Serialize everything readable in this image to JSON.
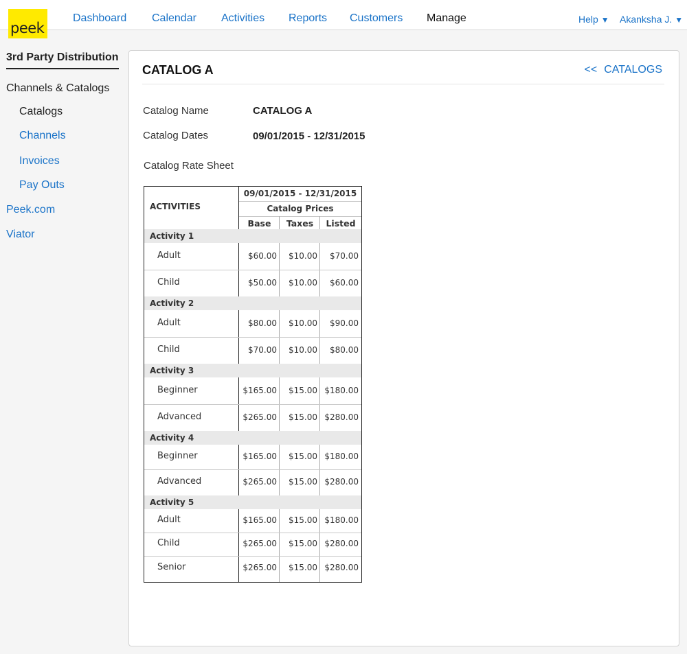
{
  "app": {
    "logo_text": "peek"
  },
  "nav": {
    "items": [
      {
        "label": "Dashboard",
        "active": false
      },
      {
        "label": "Calendar",
        "active": false
      },
      {
        "label": "Activities",
        "active": false
      },
      {
        "label": "Reports",
        "active": false
      },
      {
        "label": "Customers",
        "active": false
      },
      {
        "label": "Manage",
        "active": true
      }
    ],
    "help_label": "Help",
    "user_label": "Akanksha J."
  },
  "sidebar": {
    "heading": "3rd Party Distribution",
    "items": [
      {
        "label": "Channels & Catalogs"
      },
      {
        "label": "Catalogs"
      },
      {
        "label": "Channels"
      },
      {
        "label": "Invoices"
      },
      {
        "label": "Pay Outs"
      },
      {
        "label": "Peek.com"
      },
      {
        "label": "Viator"
      }
    ]
  },
  "catalog": {
    "title": "CATALOG A",
    "back_arrows": "<<",
    "back_label": "CATALOGS",
    "name_label": "Catalog Name",
    "name_value": "CATALOG A",
    "dates_label": "Catalog Dates",
    "dates_value": "09/01/2015 - 12/31/2015",
    "rate_sheet_label": "Catalog Rate Sheet"
  },
  "rate_table": {
    "activities_header": "ACTIVITIES",
    "date_range": "09/01/2015 - 12/31/2015",
    "prices_header": "Catalog Prices",
    "columns": [
      "Base",
      "Taxes",
      "Listed"
    ],
    "groups": [
      {
        "name": "Activity 1",
        "rows": [
          {
            "label": "Adult",
            "base": "$60.00",
            "taxes": "$10.00",
            "listed": "$70.00"
          },
          {
            "label": "Child",
            "base": "$50.00",
            "taxes": "$10.00",
            "listed": "$60.00"
          }
        ]
      },
      {
        "name": "Activity 2",
        "rows": [
          {
            "label": "Adult",
            "base": "$80.00",
            "taxes": "$10.00",
            "listed": "$90.00"
          },
          {
            "label": "Child",
            "base": "$70.00",
            "taxes": "$10.00",
            "listed": "$80.00"
          }
        ]
      },
      {
        "name": "Activity 3",
        "rows": [
          {
            "label": "Beginner",
            "base": "$165.00",
            "taxes": "$15.00",
            "listed": "$180.00"
          },
          {
            "label": "Advanced",
            "base": "$265.00",
            "taxes": "$15.00",
            "listed": "$280.00"
          }
        ]
      },
      {
        "name": "Activity 4",
        "rows": [
          {
            "label": "Beginner",
            "base": "$165.00",
            "taxes": "$15.00",
            "listed": "$180.00"
          },
          {
            "label": "Advanced",
            "base": "$265.00",
            "taxes": "$15.00",
            "listed": "$280.00"
          }
        ]
      },
      {
        "name": "Activity 5",
        "rows": [
          {
            "label": "Adult",
            "base": "$165.00",
            "taxes": "$15.00",
            "listed": "$180.00"
          },
          {
            "label": "Child",
            "base": "$265.00",
            "taxes": "$15.00",
            "listed": "$280.00"
          },
          {
            "label": "Senior",
            "base": "$265.00",
            "taxes": "$15.00",
            "listed": "$280.00"
          }
        ]
      }
    ]
  },
  "colors": {
    "link": "#1a73c8",
    "logo_bg": "#ffea00",
    "group_band": "#e9e9e9"
  }
}
